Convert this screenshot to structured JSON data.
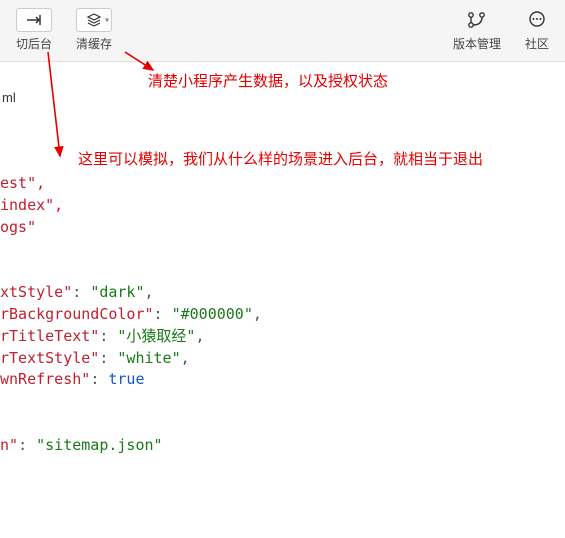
{
  "toolbar": {
    "left": [
      {
        "icon": "↦",
        "label": "切后台",
        "name": "switch-background-button",
        "hasChevron": false
      },
      {
        "icon": "≡",
        "label": "清缓存",
        "name": "clear-cache-button",
        "hasChevron": true,
        "iconStyle": "layers"
      }
    ],
    "right": [
      {
        "icon": "branch",
        "label": "版本管理",
        "name": "version-manage-button"
      },
      {
        "icon": "speech",
        "label": "社区",
        "name": "community-button"
      }
    ]
  },
  "tab_fragment": "ml",
  "annotations": {
    "clear_cache_note": "清楚小程序产生数据，以及授权状态",
    "switch_bg_note": "这里可以模拟，我们从什么样的场景进入后台，就相当于退出"
  },
  "code": {
    "frag_lines": [
      {
        "key": "est",
        "trail": "\","
      },
      {
        "key": "index",
        "trail": "\","
      },
      {
        "key": "ogs",
        "trail": "\""
      }
    ],
    "style_lines": [
      {
        "key": "xtStyle",
        "val": "dark",
        "type": "str",
        "comma": true
      },
      {
        "key": "rBackgroundColor",
        "val": "#000000",
        "type": "str",
        "comma": true
      },
      {
        "key": "rTitleText",
        "val": "小猿取经",
        "type": "str",
        "comma": true
      },
      {
        "key": "rTextStyle",
        "val": "white",
        "type": "str",
        "comma": true
      },
      {
        "key": "wnRefresh",
        "val": "true",
        "type": "kw",
        "comma": false
      }
    ],
    "sitemap": {
      "key": "n",
      "val": "sitemap.json"
    }
  }
}
